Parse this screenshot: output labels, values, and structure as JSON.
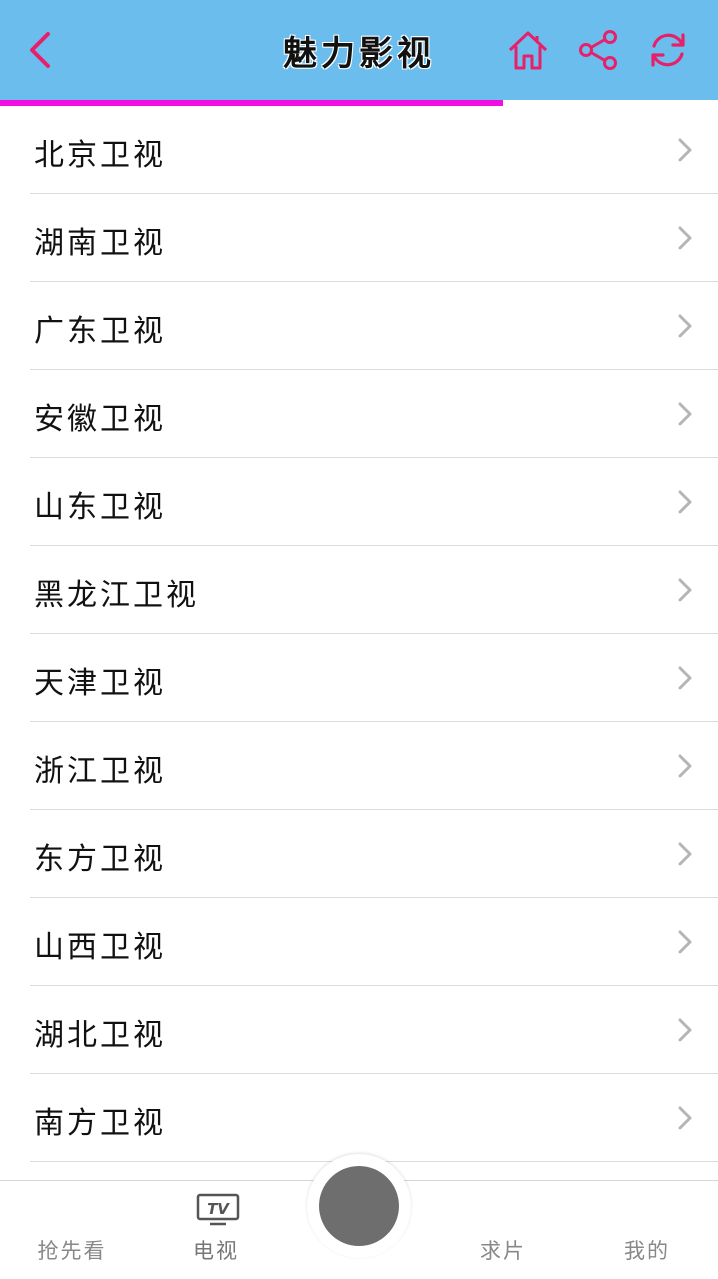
{
  "header": {
    "title": "魅力影视",
    "accent_color": "#e8206a",
    "background_color": "#6bbdee"
  },
  "progress": {
    "fraction": 0.7,
    "color": "#f20de0"
  },
  "channels": [
    "北京卫视",
    "湖南卫视",
    "广东卫视",
    "安徽卫视",
    "山东卫视",
    "黑龙江卫视",
    "天津卫视",
    "浙江卫视",
    "东方卫视",
    "山西卫视",
    "湖北卫视",
    "南方卫视"
  ],
  "tabbar": {
    "tabs": [
      {
        "label": "抢先看",
        "active": false
      },
      {
        "label": "电视",
        "active": true,
        "icon_text": "TV"
      },
      {
        "label": "求片",
        "active": false
      },
      {
        "label": "我的",
        "active": false
      }
    ]
  }
}
